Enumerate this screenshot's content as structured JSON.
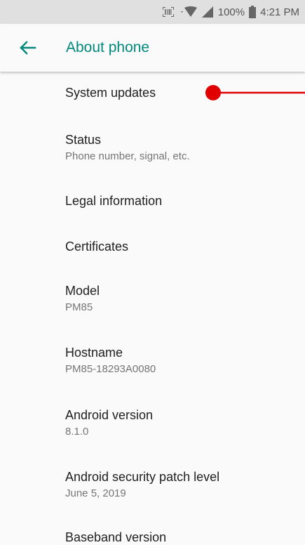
{
  "status_bar": {
    "battery_percent": "100%",
    "time": "4:21 PM",
    "icons": [
      "scanner-icon",
      "wifi-icon",
      "cell-signal-icon",
      "battery-icon"
    ]
  },
  "app_bar": {
    "back_icon": "arrow-back-icon",
    "title": "About phone",
    "accent": "#00897b"
  },
  "items": [
    {
      "title": "System updates",
      "subtitle": ""
    },
    {
      "title": "Status",
      "subtitle": "Phone number, signal, etc."
    },
    {
      "title": "Legal information",
      "subtitle": ""
    },
    {
      "title": "Certificates",
      "subtitle": ""
    },
    {
      "title": "Model",
      "subtitle": "PM85"
    },
    {
      "title": "Hostname",
      "subtitle": "PM85-18293A0080"
    },
    {
      "title": "Android version",
      "subtitle": "8.1.0"
    },
    {
      "title": "Android security patch level",
      "subtitle": "June 5, 2019"
    },
    {
      "title": "Baseband version",
      "subtitle": ""
    }
  ],
  "annotation": {
    "color": "#e00000"
  }
}
